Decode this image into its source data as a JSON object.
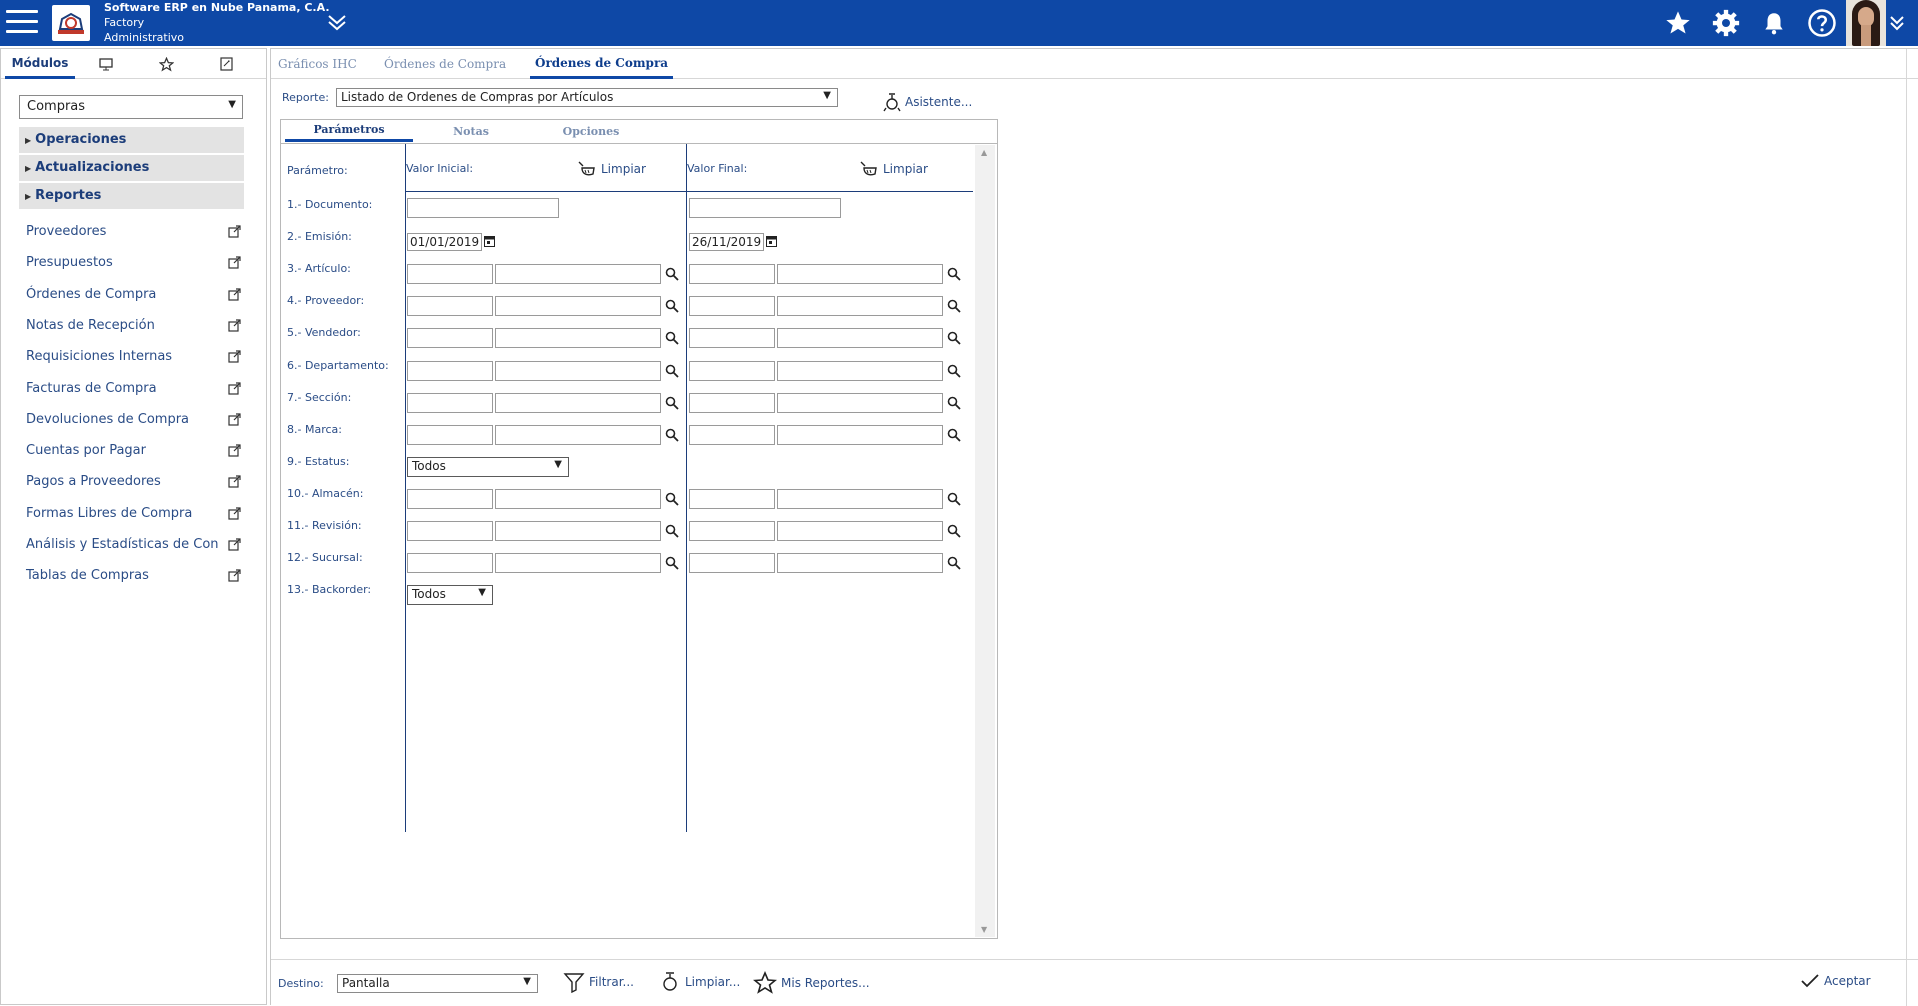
{
  "header": {
    "company_line1": "Software ERP en Nube Panama, C.A.",
    "company_line2": "Factory",
    "company_line3": "Administrativo"
  },
  "sidebar": {
    "tab_modules": "Módulos",
    "module_selected": "Compras",
    "sections": [
      "Operaciones",
      "Actualizaciones",
      "Reportes"
    ],
    "links": [
      "Proveedores",
      "Presupuestos",
      "Órdenes de Compra",
      "Notas de Recepción",
      "Requisiciones Internas",
      "Facturas de Compra",
      "Devoluciones de Compra",
      "Cuentas por Pagar",
      "Pagos a Proveedores",
      "Formas Libres de Compra",
      "Análisis y Estadísticas de Con",
      "Tablas de Compras"
    ]
  },
  "main": {
    "tabs": [
      "Gráficos IHC",
      "Órdenes de Compra",
      "Órdenes de Compra"
    ],
    "report_label": "Reporte:",
    "report_selected": "Listado de Ordenes de Compras por Artículos",
    "wizard_label": "Asistente...",
    "panel_tabs": [
      "Parámetros",
      "Notas",
      "Opciones"
    ],
    "param_header": "Parámetro:",
    "initial_header": "Valor Inicial:",
    "final_header": "Valor Final:",
    "clear_label": "Limpiar",
    "params": [
      "1.- Documento:",
      "2.- Emisión:",
      "3.- Artículo:",
      "4.- Proveedor:",
      "5.- Vendedor:",
      "6.- Departamento:",
      "7.- Sección:",
      "8.- Marca:",
      "9.- Estatus:",
      "10.- Almacén:",
      "11.- Revisión:",
      "12.- Sucursal:",
      "13.- Backorder:"
    ],
    "emision_inicial": "01/01/2019",
    "emision_final": "26/11/2019",
    "estatus_value": "Todos",
    "backorder_value": "Todos"
  },
  "footer": {
    "destino_label": "Destino:",
    "destino_value": "Pantalla",
    "filter_label": "Filtrar...",
    "clear_label": "Limpiar...",
    "my_reports_label": "Mis Reportes...",
    "accept_label": "Aceptar"
  },
  "colors": {
    "topbar": "#0e48a6",
    "accent": "#1c3d7a"
  }
}
